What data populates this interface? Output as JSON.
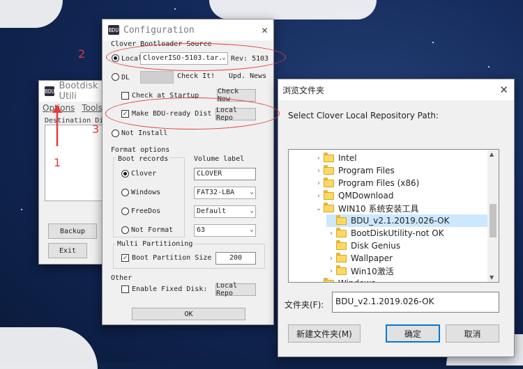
{
  "bootdisk_window": {
    "title": "Bootdisk Utili",
    "menu": [
      "Options",
      "Tools"
    ],
    "destination_label": "Destination Di",
    "backup_button": "Backup",
    "exit_button": "Exit"
  },
  "config": {
    "title": "Configuration",
    "source_header": "Clover Bootloader Source",
    "local_label": "Local",
    "local_file": "CloverISO-5103.tar.",
    "rev_label": "Rev: 5103",
    "dl_label": "DL",
    "check_it_button": "Check It!",
    "upd_news": "Upd. News",
    "check_at_startup_label": "Check at Startup",
    "check_now_button": "Check Now",
    "make_bdu_label": "Make BDU-ready Dist",
    "local_repo_button": "Local Repo",
    "not_install_label": "Not Install",
    "format_header": "Format options",
    "boot_records_header": "Boot records",
    "volume_label_header": "Volume label",
    "boot_options": [
      "Clover",
      "Windows",
      "FreeDos",
      "Not Format"
    ],
    "volume_label_value": "CLOVER",
    "fs_value": "FAT32-LBA",
    "format_mode": "Default",
    "cluster_value": "63",
    "multi_partitioning_header": "Multi Partitioning",
    "boot_partition_label": "Boot Partition Size (M",
    "boot_partition_value": "200",
    "other_header": "Other",
    "enable_fixed_label": "Enable Fixed Disk:",
    "local_repo_button2": "Local Repo",
    "ok_button": "OK"
  },
  "browse": {
    "title": "浏览文件夹",
    "prompt": "Select Clover Local Repository Path:",
    "tree": [
      {
        "label": "Intel",
        "expander": "›"
      },
      {
        "label": "Program Files",
        "expander": "›"
      },
      {
        "label": "Program Files (x86)",
        "expander": "›"
      },
      {
        "label": "QMDownload",
        "expander": "›"
      },
      {
        "label": "WIN10 系统安装工具",
        "expander": "⌄"
      },
      {
        "label": "BDU_v2.1.2019.026-OK",
        "expander": ""
      },
      {
        "label": "BootDiskUtility-not OK",
        "expander": "›"
      },
      {
        "label": "Disk Genius",
        "expander": ""
      },
      {
        "label": "Wallpaper",
        "expander": "›"
      },
      {
        "label": "Win10激活",
        "expander": "›"
      },
      {
        "label": "Windows",
        "expander": "›"
      }
    ],
    "folder_label": "文件夹(F):",
    "folder_value": "BDU_v2.1.2019.026-OK",
    "new_folder_button": "新建文件夹(M)",
    "ok_button": "确定",
    "cancel_button": "取消"
  },
  "annotations": [
    "1",
    "2",
    "3"
  ],
  "colors": {
    "annotation": "#e23b3b",
    "selection": "#cce8ff"
  }
}
